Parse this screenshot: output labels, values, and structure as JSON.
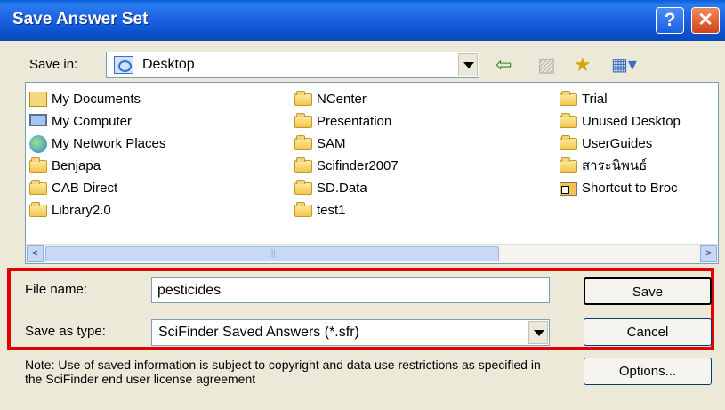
{
  "window": {
    "title": "Save Answer Set",
    "help_label": "?",
    "close_label": "✕"
  },
  "save_in": {
    "label": "Save in:",
    "value": "Desktop"
  },
  "toolbar": {
    "back": "⇦",
    "up": "▨",
    "new_folder": "★",
    "views": "▦▾"
  },
  "files": {
    "col1": [
      "My Documents",
      "My Computer",
      "My Network Places",
      "Benjapa",
      "CAB Direct",
      "Library2.0"
    ],
    "col2": [
      "NCenter",
      "Presentation",
      "SAM",
      "Scifinder2007",
      "SD.Data",
      "test1"
    ],
    "col3": [
      "Trial",
      "Unused Desktop",
      "UserGuides",
      "สาระนิพนธ์",
      "Shortcut to Broc"
    ]
  },
  "scroll": {
    "left": "<",
    "right": ">",
    "thumb": "|||"
  },
  "form": {
    "filename_label": "File name:",
    "filename_value": "pesticides",
    "type_label": "Save as type:",
    "type_value": "SciFinder Saved Answers (*.sfr)"
  },
  "buttons": {
    "save": "Save",
    "cancel": "Cancel",
    "options": "Options..."
  },
  "note": "Note:  Use of saved information is subject to copyright and data use restrictions as specified in the SciFinder end user license agreement",
  "colors": {
    "titlebar": "#0a55d8",
    "highlight": "#e00000",
    "dialog_bg": "#ece9d8"
  }
}
